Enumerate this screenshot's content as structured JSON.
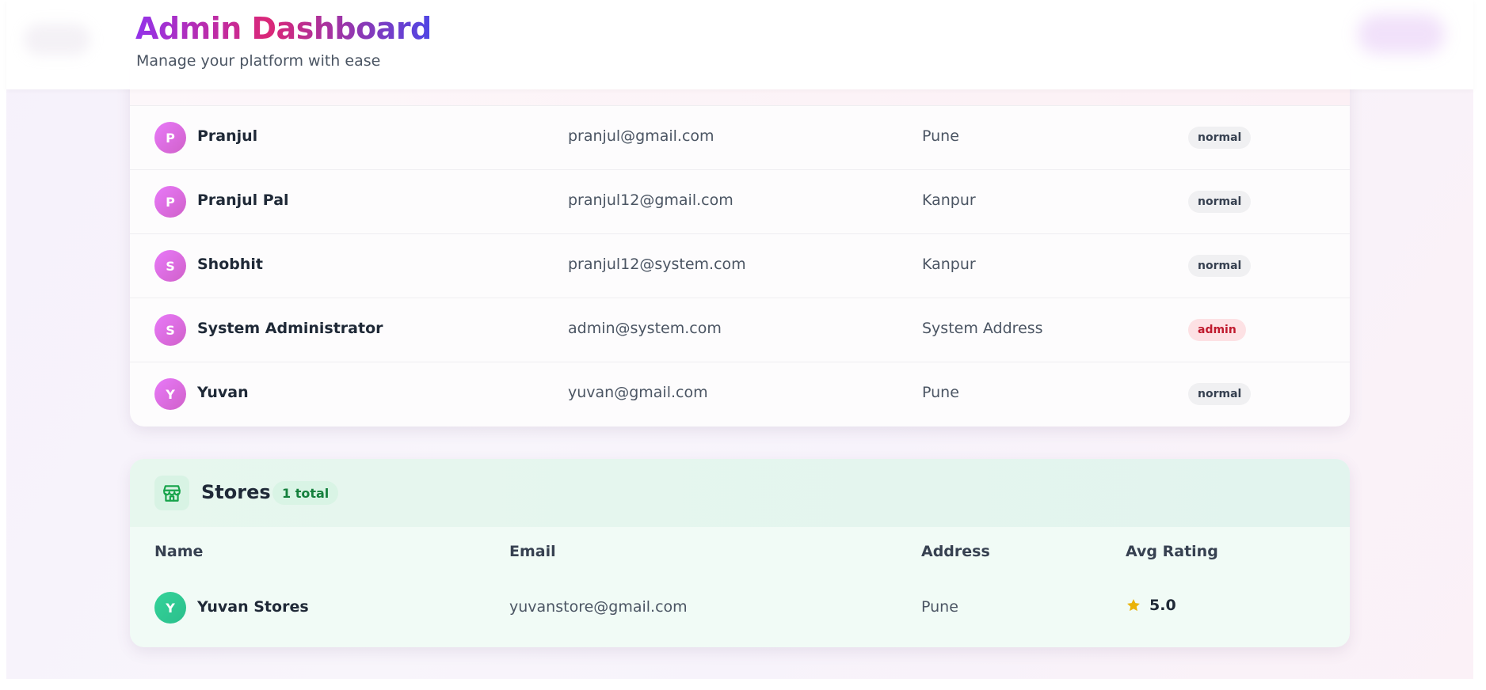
{
  "header": {
    "title": "Admin Dashboard",
    "subtitle": "Manage your platform with ease"
  },
  "users": [
    {
      "initial": "P",
      "name": "Pranjul",
      "email": "pranjul@gmail.com",
      "address": "Pune",
      "role": "normal"
    },
    {
      "initial": "P",
      "name": "Pranjul Pal",
      "email": "pranjul12@gmail.com",
      "address": "Kanpur",
      "role": "normal"
    },
    {
      "initial": "S",
      "name": "Shobhit",
      "email": "pranjul12@system.com",
      "address": "Kanpur",
      "role": "normal"
    },
    {
      "initial": "S",
      "name": "System Administrator",
      "email": "admin@system.com",
      "address": "System Address",
      "role": "admin"
    },
    {
      "initial": "Y",
      "name": "Yuvan",
      "email": "yuvan@gmail.com",
      "address": "Pune",
      "role": "normal"
    }
  ],
  "stores": {
    "title": "Stores",
    "total_label": "1 total",
    "icon": "store-icon",
    "columns": {
      "name": "Name",
      "email": "Email",
      "address": "Address",
      "rating": "Avg Rating"
    },
    "rows": [
      {
        "initial": "Y",
        "name": "Yuvan Stores",
        "email": "yuvanstore@gmail.com",
        "address": "Pune",
        "rating": "5.0"
      }
    ]
  },
  "colors": {
    "title_gradient": [
      "#9333ea",
      "#db2777",
      "#4f46e5"
    ],
    "user_avatar": "#e879f9",
    "store_avatar": "#34d399",
    "star": "#eab308"
  }
}
